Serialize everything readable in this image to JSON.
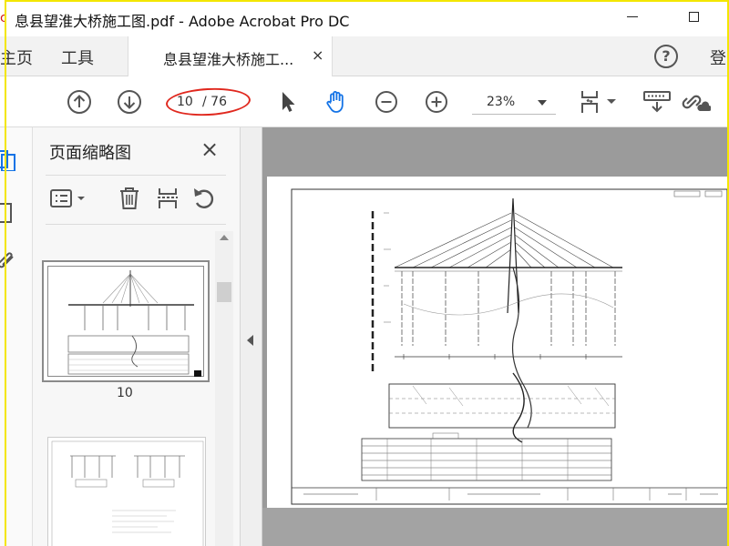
{
  "window": {
    "title": "息县望淮大桥施工图.pdf - Adobe Acrobat Pro DC"
  },
  "tabs": {
    "home_label": "主页",
    "tools_label": "工具",
    "document_label": "息县望淮大桥施工...",
    "close_glyph": "×",
    "help_glyph": "?",
    "signin_label": "登"
  },
  "toolbar": {
    "current_page": "10",
    "total_pages": "/ 76",
    "zoom": "23%",
    "icons": [
      "arrow-up-circle-icon",
      "arrow-down-circle-icon",
      "select-pointer-icon",
      "hand-tool-icon",
      "zoom-out-icon",
      "zoom-in-icon",
      "page-display-icon",
      "keyboard-download-icon",
      "share-link-icon"
    ],
    "accent_color": "#1473e6"
  },
  "left_rail": {
    "icons": [
      "page-thumbnails-icon",
      "bookmark-icon",
      "attachment-icon"
    ]
  },
  "thumbnails_panel": {
    "title": "页面缩略图",
    "close_glyph": "×",
    "tools": [
      "options-menu-icon",
      "delete-icon",
      "extract-icon",
      "rotate-icon"
    ],
    "thumbnails": [
      {
        "label": "10",
        "selected": true
      },
      {
        "label": "",
        "selected": false
      }
    ]
  },
  "annotation": {
    "color": "#e0281e"
  }
}
